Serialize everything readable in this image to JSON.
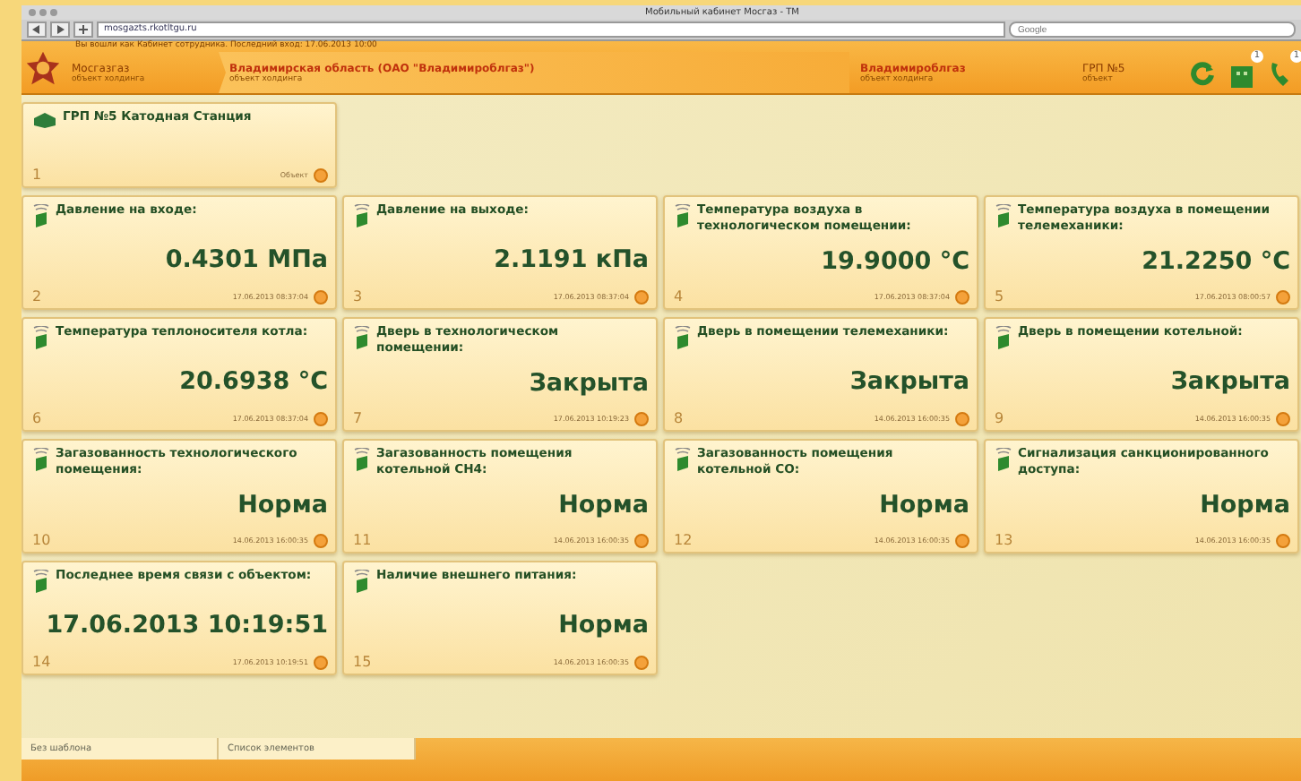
{
  "window": {
    "title": "Мобильный кабинет Мосгаз - ТМ",
    "url": "mosgazts.rkotltgu.ru",
    "search": {
      "placeholder": "Google"
    }
  },
  "header": {
    "notice": "Вы вошли как Кабинет сотрудника. Последний вход: 17.06.2013 10:00",
    "crumbs": [
      {
        "name": "Мосгазгаз",
        "sub": "объект холдинга",
        "kind": "root"
      },
      {
        "name": "Владимирская область (ОАО \"Владимироблгаз\")",
        "sub": "объект холдинга",
        "kind": "main"
      },
      {
        "name": "Владимироблгаз",
        "sub": "объект холдинга",
        "kind": "main"
      },
      {
        "name": "ГРП №5",
        "sub": "объект",
        "kind": "root"
      }
    ],
    "badges": [
      {
        "kind": "refresh"
      },
      {
        "kind": "building",
        "count": "1"
      },
      {
        "kind": "phone",
        "count": "1"
      }
    ]
  },
  "object_card": {
    "title": "ГРП №5 Катодная Станция",
    "number": "1",
    "footer": "Объект"
  },
  "sensors": [
    {
      "number": "2",
      "title": "Давление на входе:",
      "value": "0.4301 МПа",
      "time": "17.06.2013 08:37:04"
    },
    {
      "number": "3",
      "title": "Давление на выходе:",
      "value": "2.1191 кПа",
      "time": "17.06.2013 08:37:04"
    },
    {
      "number": "4",
      "title": "Температура воздуха в технологическом помещении:",
      "value": "19.9000 °C",
      "time": "17.06.2013 08:37:04"
    },
    {
      "number": "5",
      "title": "Температура воздуха в помещении телемеханики:",
      "value": "21.2250 °C",
      "time": "17.06.2013 08:00:57"
    },
    {
      "number": "6",
      "title": "Температура теплоносителя котла:",
      "value": "20.6938 °C",
      "time": "17.06.2013 08:37:04"
    },
    {
      "number": "7",
      "title": "Дверь в технологическом помещении:",
      "value": "Закрыта",
      "time": "17.06.2013 10:19:23"
    },
    {
      "number": "8",
      "title": "Дверь в помещении телемеханики:",
      "value": "Закрыта",
      "time": "14.06.2013 16:00:35"
    },
    {
      "number": "9",
      "title": "Дверь в помещении котельной:",
      "value": "Закрыта",
      "time": "14.06.2013 16:00:35"
    },
    {
      "number": "10",
      "title": "Загазованность технологического помещения:",
      "value": "Норма",
      "time": "14.06.2013 16:00:35"
    },
    {
      "number": "11",
      "title": "Загазованность помещения котельной CH4:",
      "value": "Норма",
      "time": "14.06.2013 16:00:35"
    },
    {
      "number": "12",
      "title": "Загазованность помещения котельной CO:",
      "value": "Норма",
      "time": "14.06.2013 16:00:35"
    },
    {
      "number": "13",
      "title": "Сигнализация санкционированного доступа:",
      "value": "Норма",
      "time": "14.06.2013 16:00:35"
    },
    {
      "number": "14",
      "title": "Последнее время связи с объектом:",
      "value": "17.06.2013 10:19:51",
      "time": "17.06.2013 10:19:51"
    },
    {
      "number": "15",
      "title": "Наличие внешнего питания:",
      "value": "Норма",
      "time": "14.06.2013 16:00:35"
    }
  ],
  "status_bar": [
    "Без шаблона",
    "Список элементов"
  ]
}
